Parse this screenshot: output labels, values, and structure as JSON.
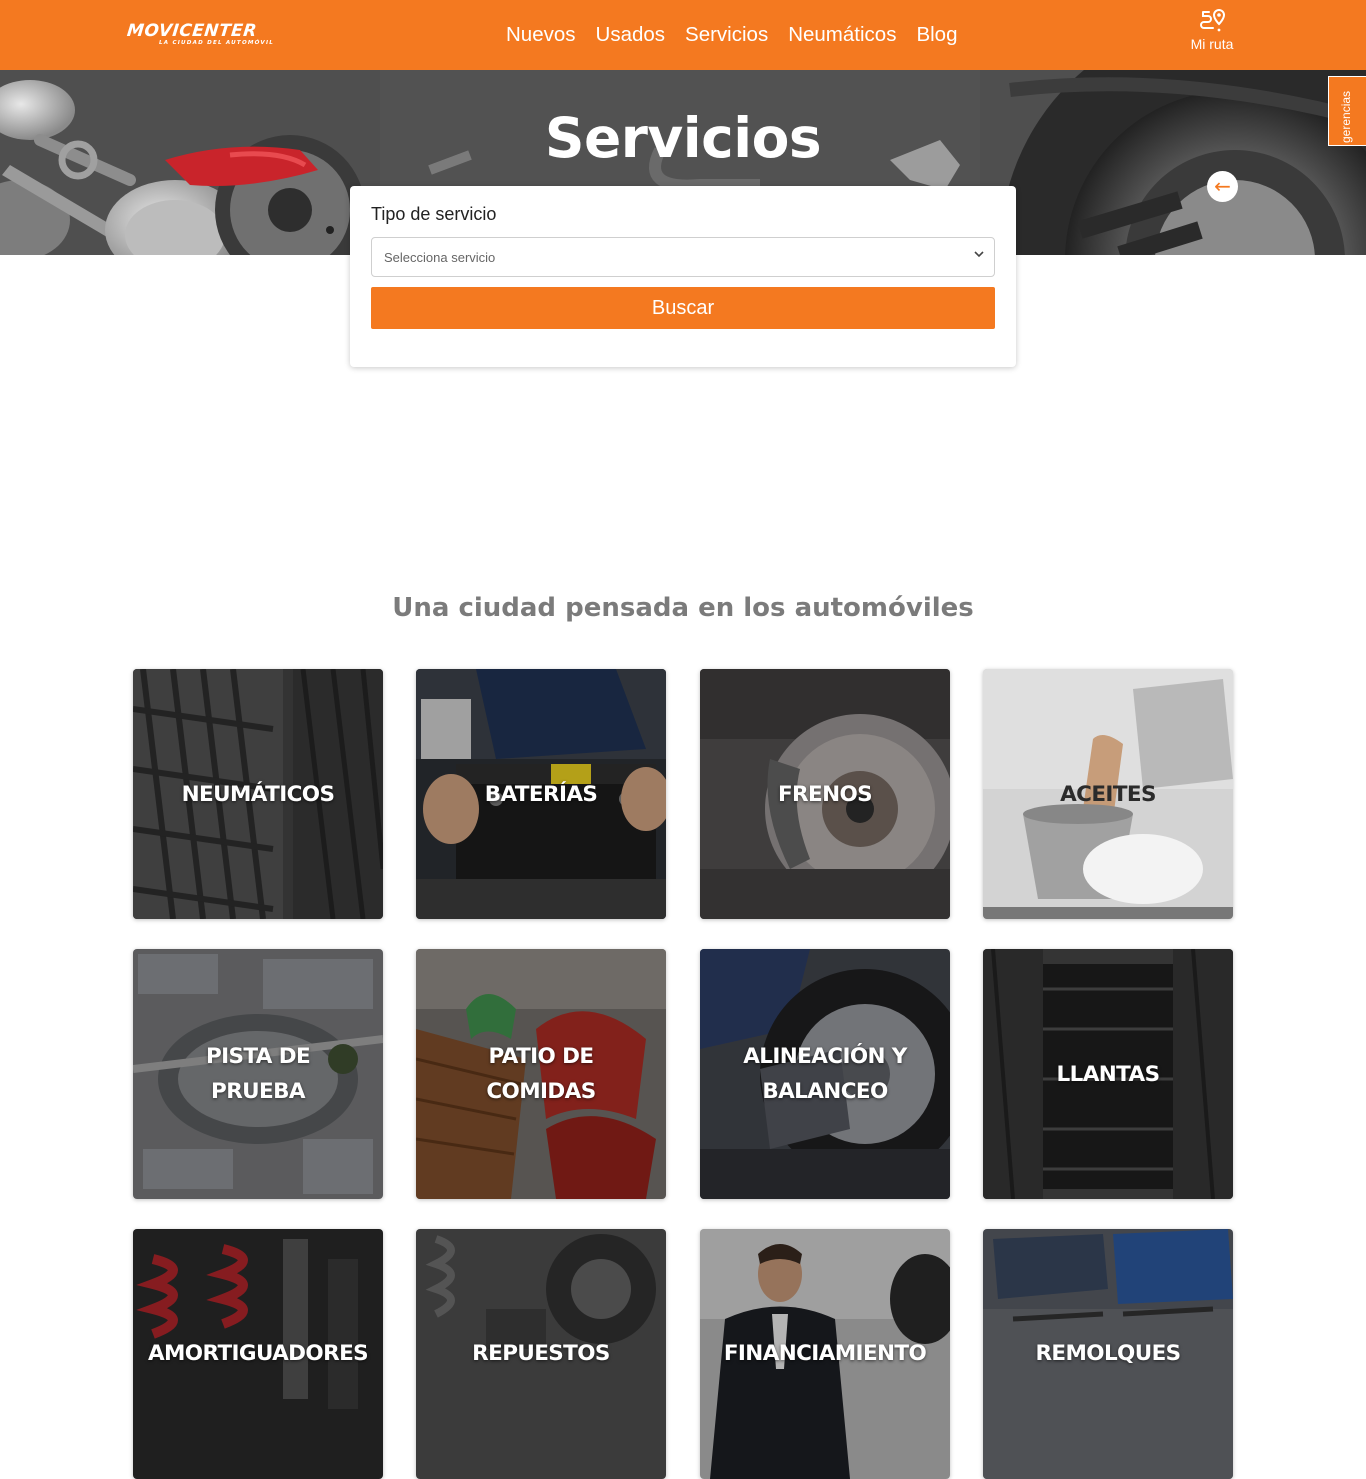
{
  "brand": {
    "name": "MOVICENTER",
    "tagline": "LA CIUDAD DEL AUTOMÓVIL",
    "accent_color": "#f47920"
  },
  "nav": {
    "items": [
      {
        "label": "Nuevos"
      },
      {
        "label": "Usados"
      },
      {
        "label": "Servicios"
      },
      {
        "label": "Neumáticos"
      },
      {
        "label": "Blog"
      }
    ]
  },
  "route": {
    "label": "Mi ruta",
    "icon": "route-map-pin-icon"
  },
  "side_tab": {
    "label": "gerencias"
  },
  "hero": {
    "title": "Servicios",
    "back_icon": "arrow-left-icon"
  },
  "search": {
    "label": "Tipo de servicio",
    "select_value": "Selecciona servicio",
    "button_label": "Buscar"
  },
  "section": {
    "title": "Una ciudad pensada en los automóviles",
    "tiles": [
      {
        "label": "NEUMÁTICOS",
        "image": "tires-photo"
      },
      {
        "label": "BATERÍAS",
        "image": "car-battery-photo"
      },
      {
        "label": "FRENOS",
        "image": "brake-disc-photo"
      },
      {
        "label": "ACEITES",
        "image": "motor-oil-photo"
      },
      {
        "label": "PISTA DE PRUEBA",
        "image": "aerial-test-track-photo"
      },
      {
        "label": "PATIO DE COMIDAS",
        "image": "food-court-chairs-photo"
      },
      {
        "label": "ALINEACIÓN Y BALANCEO",
        "image": "wheel-alignment-photo"
      },
      {
        "label": "LLANTAS",
        "image": "steel-rims-photo"
      },
      {
        "label": "AMORTIGUADORES",
        "image": "shock-absorbers-photo"
      },
      {
        "label": "REPUESTOS",
        "image": "spare-parts-photo"
      },
      {
        "label": "FINANCIAMIENTO",
        "image": "salesman-handshake-photo"
      },
      {
        "label": "REMOLQUES",
        "image": "trailers-photo"
      }
    ]
  }
}
